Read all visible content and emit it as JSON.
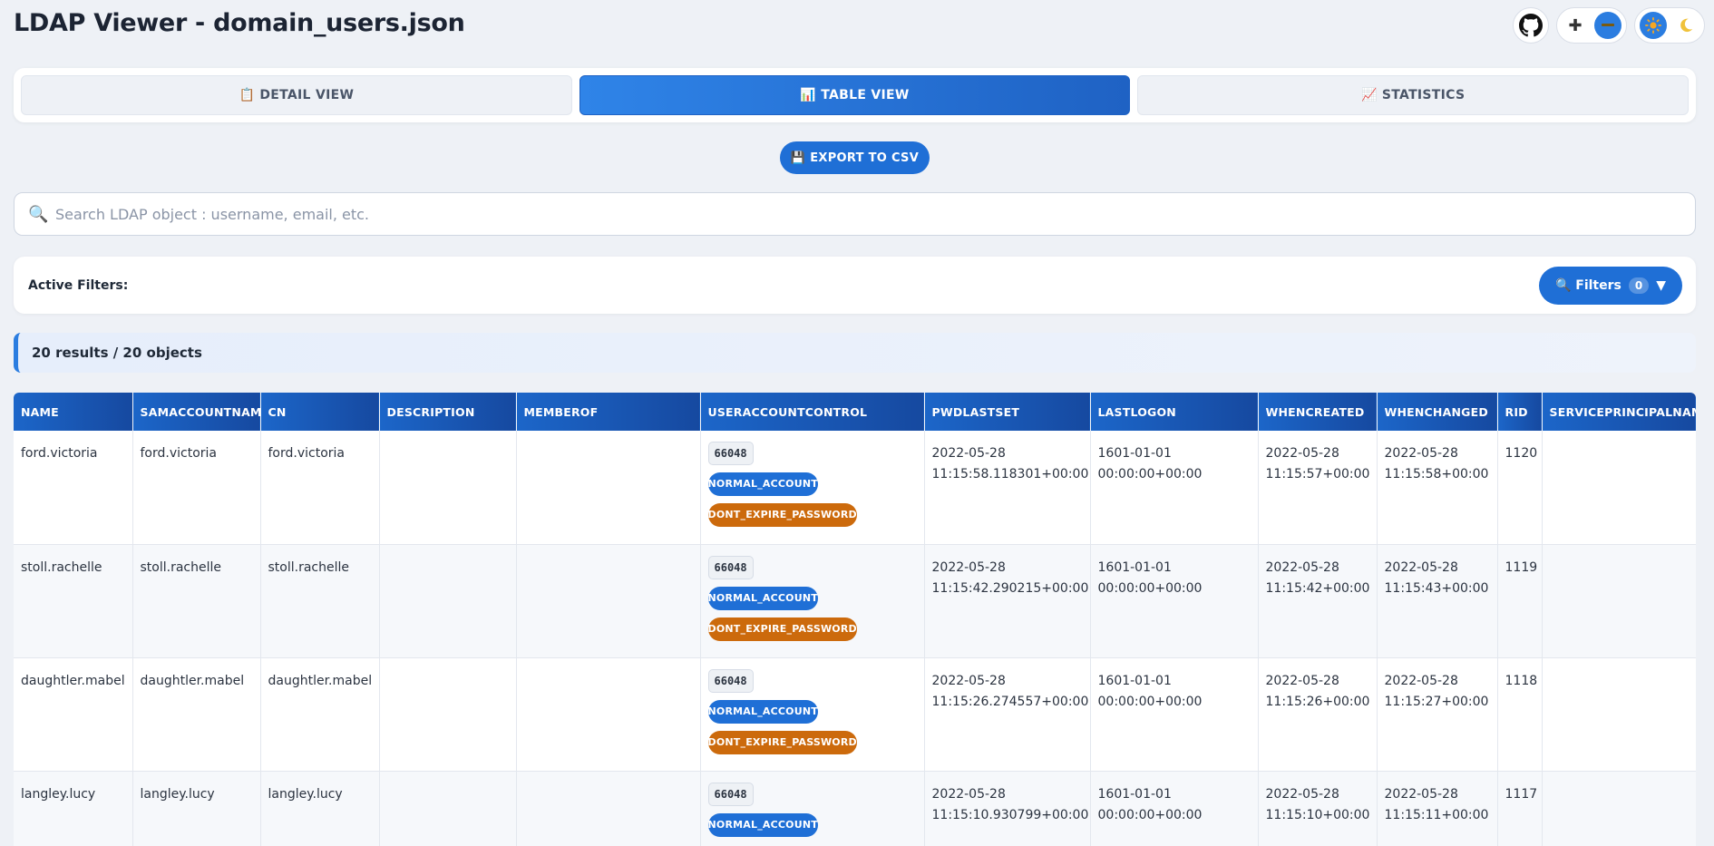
{
  "app": {
    "title": "LDAP Viewer - domain_users.json"
  },
  "tabs": [
    {
      "label": "📋 DETAIL VIEW",
      "active": false
    },
    {
      "label": "📊 TABLE VIEW",
      "active": true
    },
    {
      "label": "📈 STATISTICS",
      "active": false
    }
  ],
  "export": {
    "label": "💾 EXPORT TO CSV"
  },
  "search": {
    "placeholder": "Search LDAP object : username, email, etc.",
    "value": ""
  },
  "filters": {
    "active_label": "Active Filters:",
    "button_label": "🔍 Filters",
    "count": "0"
  },
  "results": {
    "summary": "20 results / 20 objects"
  },
  "colors": {
    "accent": "#1f6fd6",
    "flag_normal": "#1f6fd6",
    "flag_dont_expire": "#cc6a0c"
  },
  "table": {
    "columns": [
      "NAME",
      "SAMACCOUNTNAME",
      "CN",
      "DESCRIPTION",
      "MEMBEROF",
      "USERACCOUNTCONTROL",
      "PWDLASTSET",
      "LASTLOGON",
      "WHENCREATED",
      "WHENCHANGED",
      "RID",
      "SERVICEPRINCIPALNAME"
    ],
    "rows": [
      {
        "name": "ford.victoria",
        "samaccountname": "ford.victoria",
        "cn": "ford.victoria",
        "description": "",
        "memberof": "",
        "uac": "66048",
        "flags": [
          "NORMAL_ACCOUNT",
          "DONT_EXPIRE_PASSWORD"
        ],
        "pwdlastset": [
          "2022-05-28",
          "11:15:58.118301+00:00"
        ],
        "lastlogon": [
          "1601-01-01",
          "00:00:00+00:00"
        ],
        "whencreated": [
          "2022-05-28",
          "11:15:57+00:00"
        ],
        "whenchanged": [
          "2022-05-28",
          "11:15:58+00:00"
        ],
        "rid": "1120",
        "spn": ""
      },
      {
        "name": "stoll.rachelle",
        "samaccountname": "stoll.rachelle",
        "cn": "stoll.rachelle",
        "description": "",
        "memberof": "",
        "uac": "66048",
        "flags": [
          "NORMAL_ACCOUNT",
          "DONT_EXPIRE_PASSWORD"
        ],
        "pwdlastset": [
          "2022-05-28",
          "11:15:42.290215+00:00"
        ],
        "lastlogon": [
          "1601-01-01",
          "00:00:00+00:00"
        ],
        "whencreated": [
          "2022-05-28",
          "11:15:42+00:00"
        ],
        "whenchanged": [
          "2022-05-28",
          "11:15:43+00:00"
        ],
        "rid": "1119",
        "spn": ""
      },
      {
        "name": "daughtler.mabel",
        "samaccountname": "daughtler.mabel",
        "cn": "daughtler.mabel",
        "description": "",
        "memberof": "",
        "uac": "66048",
        "flags": [
          "NORMAL_ACCOUNT",
          "DONT_EXPIRE_PASSWORD"
        ],
        "pwdlastset": [
          "2022-05-28",
          "11:15:26.274557+00:00"
        ],
        "lastlogon": [
          "1601-01-01",
          "00:00:00+00:00"
        ],
        "whencreated": [
          "2022-05-28",
          "11:15:26+00:00"
        ],
        "whenchanged": [
          "2022-05-28",
          "11:15:27+00:00"
        ],
        "rid": "1118",
        "spn": ""
      },
      {
        "name": "langley.lucy",
        "samaccountname": "langley.lucy",
        "cn": "langley.lucy",
        "description": "",
        "memberof": "",
        "uac": "66048",
        "flags": [
          "NORMAL_ACCOUNT"
        ],
        "pwdlastset": [
          "2022-05-28",
          "11:15:10.930799+00:00"
        ],
        "lastlogon": [
          "1601-01-01",
          "00:00:00+00:00"
        ],
        "whencreated": [
          "2022-05-28",
          "11:15:10+00:00"
        ],
        "whenchanged": [
          "2022-05-28",
          "11:15:11+00:00"
        ],
        "rid": "1117",
        "spn": ""
      }
    ]
  }
}
